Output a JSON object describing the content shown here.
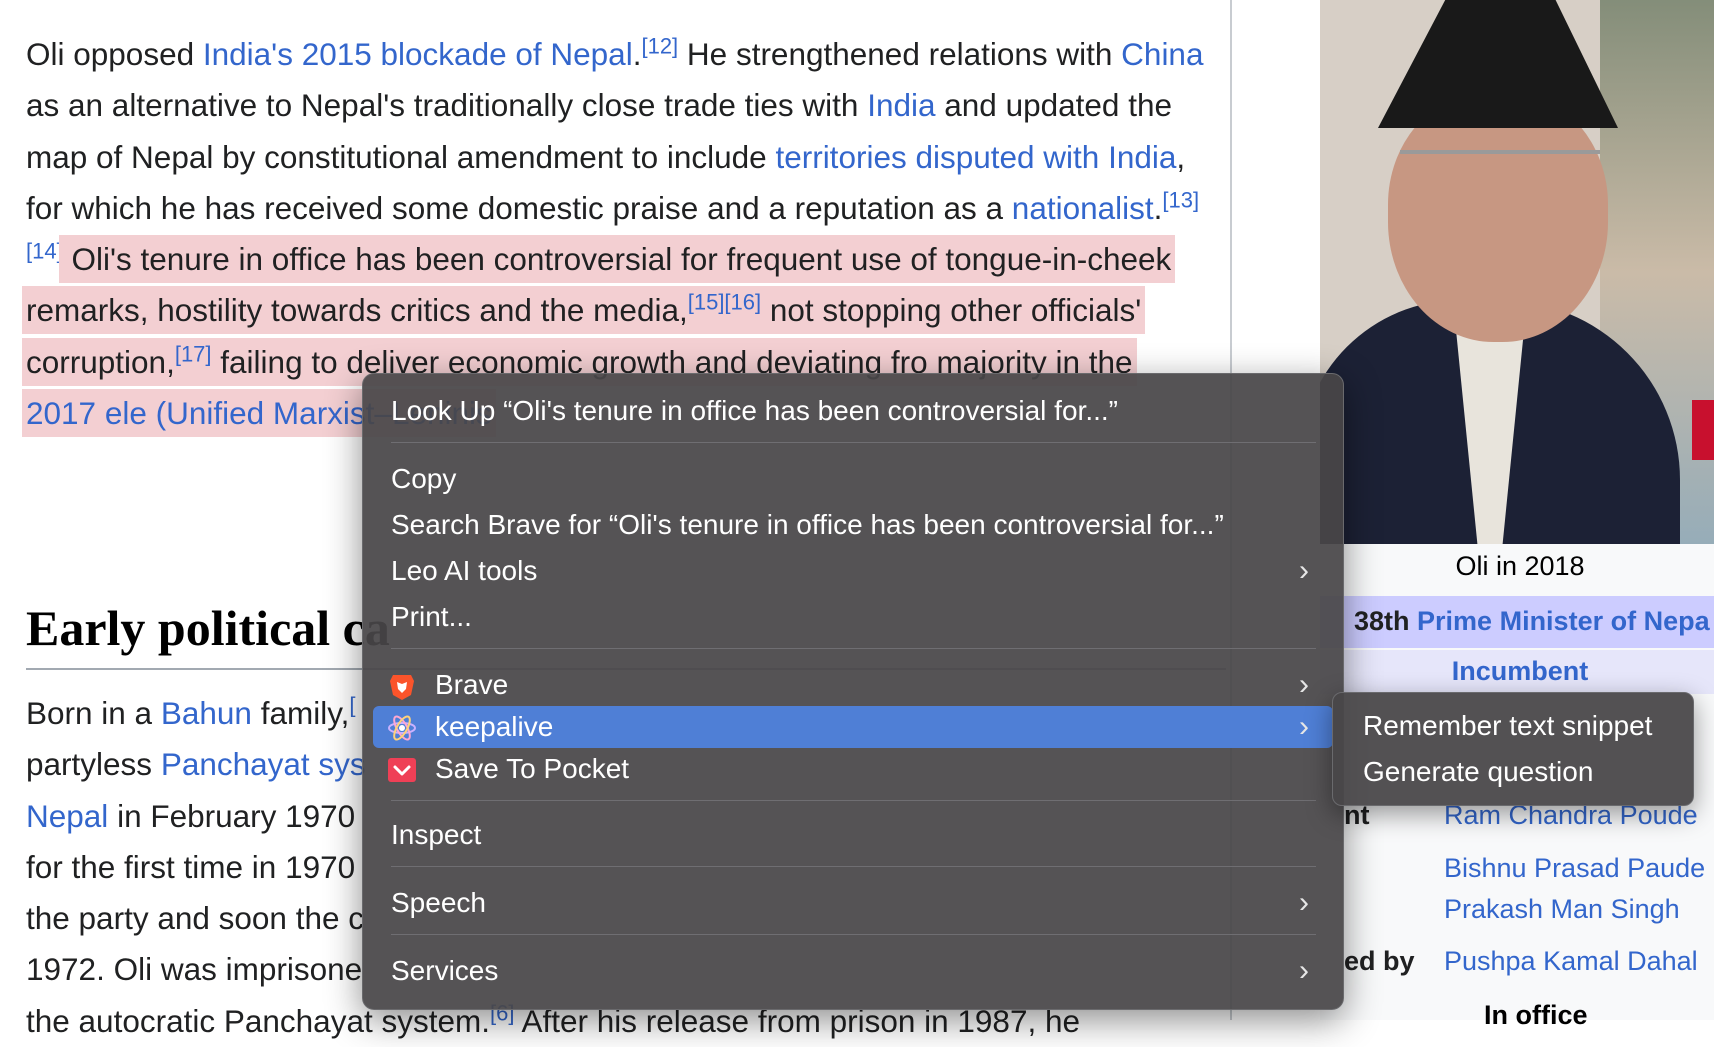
{
  "article": {
    "intro": {
      "t1": "Oli opposed ",
      "l1": "India's 2015 blockade of Nepal",
      "t2": ".",
      "r1": "[12]",
      "t3": " He strengthened relations with ",
      "l2": "China",
      "t4": " as an alternative to Nepal's traditionally close trade ties with ",
      "l3": "India",
      "t5": " and updated the map of Nepal by constitutional amendment to include ",
      "l4": "territories disputed with India",
      "t6": ", for which he has received some domestic praise and a reputation as a ",
      "l5": "nationalist",
      "t7": ".",
      "r2": "[13][14]",
      "h1": " Oli's tenure in office has been controversial for frequent use of tongue-in-cheek remarks, hostility towards critics and the media,",
      "r3": "[15][16]",
      "h2": " not stopping other officials' corruption,",
      "r4": "[17]",
      "h3": " failing to deliver economic growth and deviating fro",
      "h4": " majority in the ",
      "l6": "2017 ele",
      "l7": "(Unified Marxist–Leninis"
    },
    "heading": "Early political ca",
    "early": {
      "t1": "Born in a ",
      "l1": "Bahun",
      "t2": " family,",
      "r1": "[",
      "t3": " partyless ",
      "l2": "Panchayat sys",
      "l3": "Nepal",
      "t4": " in February 1970",
      "t5": " for the first time in 1970",
      "t6": " the party and soon the c",
      "t7": " 1972. Oli was imprisone",
      "t8": " the autocratic Panchayat system.",
      "r2": "[6]",
      "t9": " After his release from prison in 1987, he"
    }
  },
  "infobox": {
    "caption": "Oli in 2018",
    "pm_prefix": "38th ",
    "pm_link": "Prime Minister of Nepa",
    "incumbent": "Incumbent",
    "rows": [
      {
        "label": "nt",
        "value": "Ram Chandra Poude"
      },
      {
        "label": "",
        "value": "Bishnu Prasad Paude"
      },
      {
        "label": "",
        "value": "Prakash Man Singh"
      },
      {
        "label": "ed by",
        "value": "Pushpa Kamal Dahal"
      }
    ],
    "in_office": "In office"
  },
  "context_menu": {
    "lookup": "Look Up “Oli's tenure in office has been controversial for...”",
    "copy": "Copy",
    "search": "Search Brave for “Oli's tenure in office has been controversial for...”",
    "leo": "Leo AI tools",
    "print": "Print...",
    "brave": "Brave",
    "keepalive": "keepalive",
    "pocket": "Save To Pocket",
    "inspect": "Inspect",
    "speech": "Speech",
    "services": "Services",
    "chevron": "›"
  },
  "submenu": {
    "remember": "Remember text snippet",
    "generate": "Generate question"
  },
  "colors": {
    "link": "#3366cc",
    "highlight": "#f3cfd2",
    "menu_active": "#4f7fd6"
  }
}
